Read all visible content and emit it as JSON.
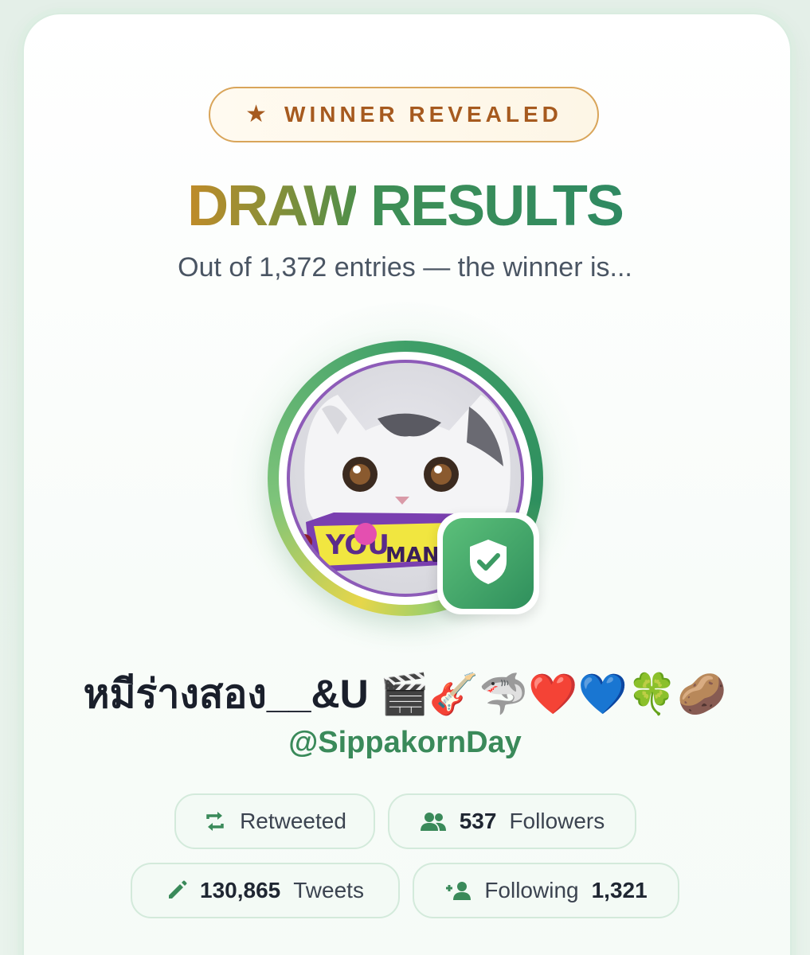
{
  "badge": {
    "icon": "star-icon",
    "star_glyph": "★",
    "label": "WINNER REVEALED"
  },
  "heading": {
    "word1": "DRAW",
    "word2": "RESULTS"
  },
  "subtitle": "Out of 1,372 entries — the winner is...",
  "winner": {
    "display_name": "หมีร่างสอง__&U 🎬🎸🦈❤️💙🍀🥔",
    "handle": "@SippakornDay",
    "verified_icon": "shield-check-icon"
  },
  "stats": {
    "retweeted": {
      "icon": "retweet-icon",
      "label": "Retweeted"
    },
    "followers": {
      "icon": "people-icon",
      "value": "537",
      "label": "Followers"
    },
    "tweets": {
      "icon": "pencil-icon",
      "value": "130,865",
      "label": "Tweets"
    },
    "following": {
      "icon": "person-add-icon",
      "label": "Following",
      "value": "1,321"
    }
  },
  "colors": {
    "accent_green": "#3a8a5a",
    "badge_orange": "#a65a1f",
    "gold": "#c08b29"
  }
}
